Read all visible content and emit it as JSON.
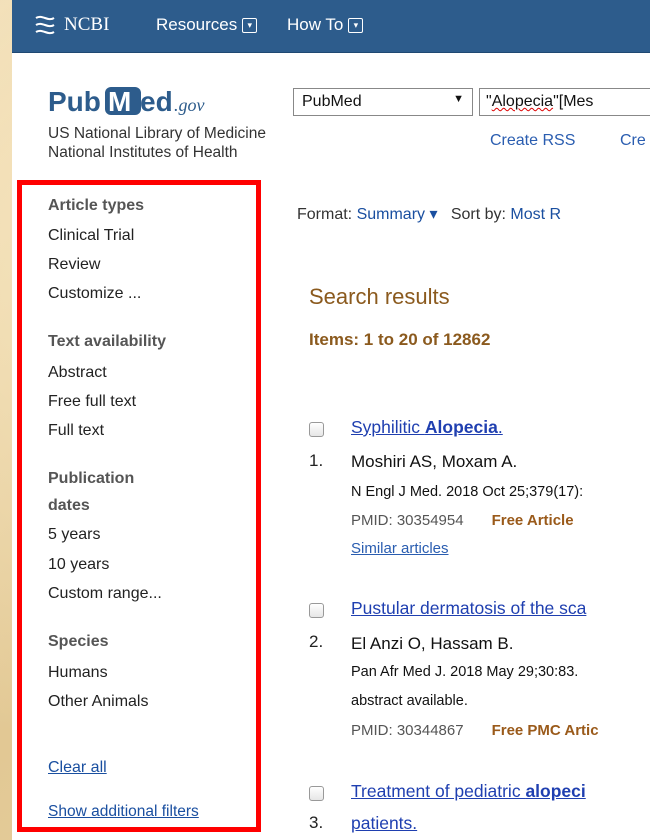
{
  "header": {
    "ncbi_label": "NCBI",
    "menus": [
      {
        "label": "Resources",
        "icon": "chevron-down-icon"
      },
      {
        "label": "How To",
        "icon": "chevron-down-icon"
      }
    ]
  },
  "brand": {
    "logo_pub": "Pub",
    "logo_med": "Med",
    "logo_gov": ".gov",
    "nlm_text": "US National Library of Medicine National Institutes of Health"
  },
  "search": {
    "database": "PubMed",
    "query_underlined": "Alopecia",
    "query_rest": "[Mes",
    "create_rss": "Create RSS",
    "create_alert": "Cre"
  },
  "filters": {
    "article_types": {
      "heading": "Article types",
      "items": [
        "Clinical Trial",
        "Review",
        "Customize ..."
      ]
    },
    "text_availability": {
      "heading": "Text availability",
      "items": [
        "Abstract",
        "Free full text",
        "Full text"
      ]
    },
    "publication_dates": {
      "heading_line1": "Publication",
      "heading_line2": "dates",
      "items": [
        "5 years",
        "10 years",
        "Custom range..."
      ]
    },
    "species": {
      "heading": "Species",
      "items": [
        "Humans",
        "Other Animals"
      ]
    },
    "clear_all": "Clear all",
    "show_additional": "Show additional filters"
  },
  "results_bar": {
    "format_label": "Format",
    "format_value": "Summary",
    "sort_label": "Sort by",
    "sort_value": "Most R"
  },
  "results": {
    "title": "Search results",
    "items_text": "Items: 1 to 20 of 12862",
    "list": [
      {
        "number": "1.",
        "title_pre": "Syphilitic ",
        "title_bold": "Alopecia",
        "title_post": ".",
        "authors": "Moshiri AS, Moxam A.",
        "journal": "N Engl J Med. 2018 Oct 25;379(17):",
        "pmid": "PMID: 30354954",
        "badge": "Free Article",
        "similar": "Similar articles"
      },
      {
        "number": "2.",
        "title": "Pustular dermatosis of the sca",
        "authors": "El Anzi O, Hassam B.",
        "journal": "Pan Afr Med J. 2018 May 29;30:83.",
        "note": "abstract available.",
        "pmid": "PMID: 30344867",
        "badge": "Free PMC Artic"
      },
      {
        "number": "3.",
        "title_pre": "Treatment of pediatric ",
        "title_bold": "alopeci",
        "title_line2": "patients."
      }
    ]
  },
  "colors": {
    "header_bg": "#2d5c8c",
    "highlight_border": "#ff0000",
    "link": "#1f3fb0",
    "heading_brown": "#8b5a1e"
  }
}
